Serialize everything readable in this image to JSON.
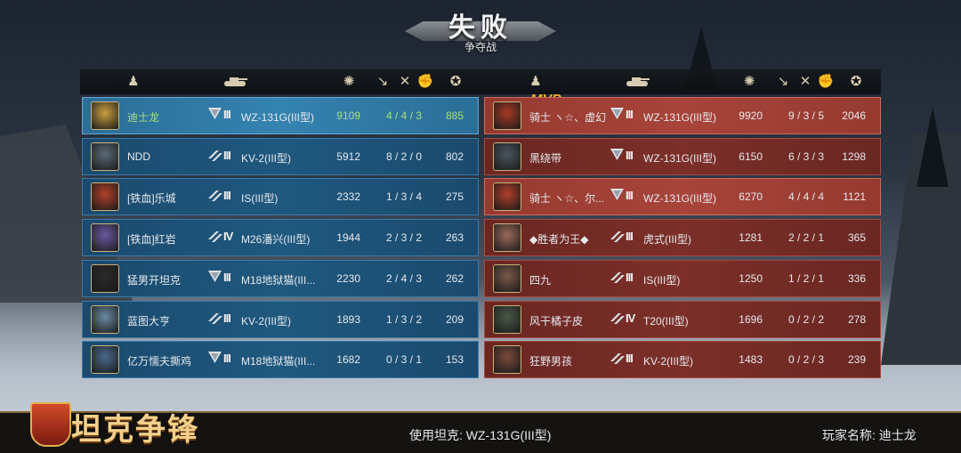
{
  "title": {
    "main": "失败",
    "sub": "争夺战"
  },
  "header_icons": [
    "player-icon",
    "tank-icon",
    "damage-icon",
    "kill-icon",
    "assist-icon",
    "block-icon",
    "score-icon"
  ],
  "mvp_label": "MVP",
  "blue_team": [
    {
      "name": "迪士龙",
      "tier": "III",
      "tank": "WZ-131G(III型)",
      "damage": "9109",
      "kda": "4 / 4 / 3",
      "points": "885",
      "highlight": true,
      "rank": "chevron"
    },
    {
      "name": "NDD",
      "tier": "III",
      "tank": "KV-2(III型)",
      "damage": "5912",
      "kda": "8 / 2 / 0",
      "points": "802",
      "highlight": false,
      "rank": "stripes"
    },
    {
      "name": "[铁血]乐城",
      "tier": "III",
      "tank": "IS(III型)",
      "damage": "2332",
      "kda": "1 / 3 / 4",
      "points": "275",
      "highlight": false,
      "rank": "stripes"
    },
    {
      "name": "[铁血]红岩",
      "tier": "IV",
      "tank": "M26潘兴(III型)",
      "damage": "1944",
      "kda": "2 / 3 / 2",
      "points": "263",
      "highlight": false,
      "rank": "stripes"
    },
    {
      "name": "猛男开坦克",
      "tier": "III",
      "tank": "M18地狱猫(III...",
      "damage": "2230",
      "kda": "2 / 4 / 3",
      "points": "262",
      "highlight": false,
      "rank": "chevron"
    },
    {
      "name": "蓝图大亨",
      "tier": "III",
      "tank": "KV-2(III型)",
      "damage": "1893",
      "kda": "1 / 3 / 2",
      "points": "209",
      "highlight": false,
      "rank": "stripes"
    },
    {
      "name": "亿万懦夫撕鸡",
      "tier": "III",
      "tank": "M18地狱猫(III...",
      "damage": "1682",
      "kda": "0 / 3 / 1",
      "points": "153",
      "highlight": false,
      "rank": "chevron"
    }
  ],
  "red_team": [
    {
      "name": "骑士 ヽ☆、虚幻",
      "tier": "III",
      "tank": "WZ-131G(III型)",
      "damage": "9920",
      "kda": "9 / 3 / 5",
      "points": "2046",
      "highlight": true,
      "rank": "chevron"
    },
    {
      "name": "黑绕带",
      "tier": "III",
      "tank": "WZ-131G(III型)",
      "damage": "6150",
      "kda": "6 / 3 / 3",
      "points": "1298",
      "highlight": false,
      "rank": "chevron"
    },
    {
      "name": "骑士 ヽ☆、尔...",
      "tier": "III",
      "tank": "WZ-131G(III型)",
      "damage": "6270",
      "kda": "4 / 4 / 4",
      "points": "1121",
      "highlight": true,
      "rank": "chevron"
    },
    {
      "name": "◆胜者为王◆",
      "tier": "III",
      "tank": "虎式(III型)",
      "damage": "1281",
      "kda": "2 / 2 / 1",
      "points": "365",
      "highlight": false,
      "rank": "stripes"
    },
    {
      "name": "四九",
      "tier": "III",
      "tank": "IS(III型)",
      "damage": "1250",
      "kda": "1 / 2 / 1",
      "points": "336",
      "highlight": false,
      "rank": "stripes"
    },
    {
      "name": "风干橘子皮",
      "tier": "IV",
      "tank": "T20(III型)",
      "damage": "1696",
      "kda": "0 / 2 / 2",
      "points": "278",
      "highlight": false,
      "rank": "stripes"
    },
    {
      "name": "狂野男孩",
      "tier": "III",
      "tank": "KV-2(III型)",
      "damage": "1483",
      "kda": "0 / 2 / 3",
      "points": "239",
      "highlight": false,
      "rank": "stripes"
    }
  ],
  "footer": {
    "logo": "坦克争锋",
    "tank_used": "使用坦克: WZ-131G(III型)",
    "player_name": "玩家名称: 迪士龙"
  },
  "colors": {
    "blue_row": "#1f587e",
    "red_row": "#7c2f29",
    "accent_gold": "#f0b030",
    "green_text": "#a8e070"
  }
}
